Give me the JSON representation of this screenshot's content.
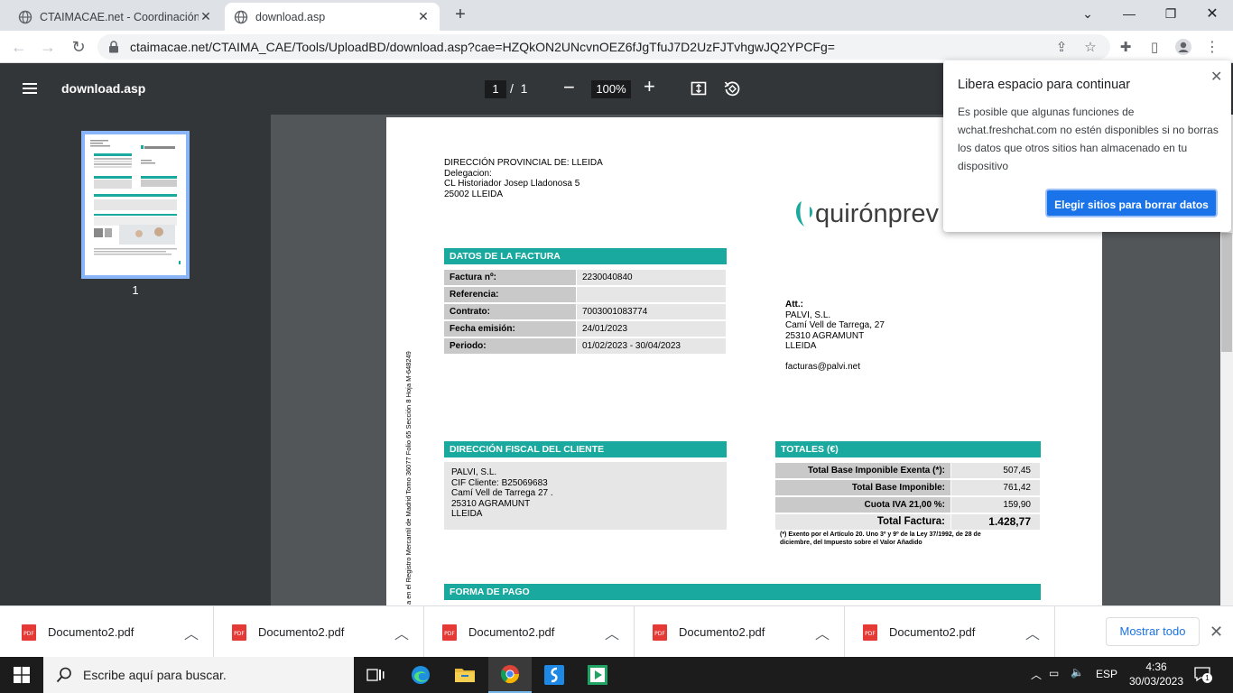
{
  "browser": {
    "tabs": [
      {
        "title": "CTAIMACAE.net - Coordinación de",
        "active": false
      },
      {
        "title": "download.asp",
        "active": true
      }
    ],
    "new_tab_label": "+",
    "url": "ctaimacae.net/CTAIMA_CAE/Tools/UploadBD/download.asp?cae=HZQkON2UNcvnOEZ6fJgTfuJ7D2UzFJTvhgwJQ2YPCFg="
  },
  "pdf_viewer": {
    "file_name": "download.asp",
    "current_page": "1",
    "page_separator": "/",
    "total_pages": "1",
    "zoom": "100%",
    "thumbnail_number": "1"
  },
  "document": {
    "sender": {
      "line1": "DIRECCIÓN PROVINCIAL DE: LLEIDA",
      "line2": "Delegacion:",
      "line3": "CL Historiador Josep Lladonosa 5",
      "line4": "25002 LLEIDA"
    },
    "logo_text": "quirónprev",
    "invoice_section_title": "DATOS DE LA FACTURA",
    "invoice_rows": [
      {
        "label": "Factura nº:",
        "value": "2230040840"
      },
      {
        "label": "Referencia:",
        "value": ""
      },
      {
        "label": "Contrato:",
        "value": "7003001083774"
      },
      {
        "label": "Fecha emisión:",
        "value": "24/01/2023"
      },
      {
        "label": "Periodo:",
        "value": "01/02/2023 - 30/04/2023"
      }
    ],
    "recipient": {
      "line1": "Att.:",
      "line2": "PALVI, S.L.",
      "line3": "Camí Vell de Tarrega, 27",
      "line4": "25310 AGRAMUNT",
      "line5": "LLEIDA",
      "email": "facturas@palvi.net"
    },
    "vertical_note": "a en el Registro Mercantil de Madrid Tomo 36077 Folio 65 Sección 8 Hoja M-648249",
    "fiscal_section_title": "DIRECCIÓN FISCAL DEL CLIENTE",
    "fiscal": {
      "line1": "PALVI, S.L.",
      "line2": "CIF Cliente: B25069683",
      "line3": "Camí Vell de Tarrega  27 .",
      "line4": "25310 AGRAMUNT",
      "line5": "LLEIDA"
    },
    "totals_section_title": "TOTALES (€)",
    "totals_rows": [
      {
        "label": "Total Base Imponible Exenta (*):",
        "value": "507,45"
      },
      {
        "label": "Total Base Imponible:",
        "value": "761,42"
      },
      {
        "label": "Cuota IVA 21,00 %:",
        "value": "159,90"
      }
    ],
    "total_label": "Total Factura:",
    "total_value": "1.428,77",
    "footnote_line1": "(*) Exento por el Artículo 20. Uno 3º y 9º de la Ley 37/1992, de 28 de",
    "footnote_line2": "diciembre, del Impuesto sobre el Valor Añadido",
    "payment_section_title": "FORMA DE PAGO"
  },
  "popup": {
    "title": "Libera espacio para continuar",
    "body": "Es posible que algunas funciones de wchat.freshchat.com no estén disponibles si no borras los datos que otros sitios han almacenado en tu dispositivo",
    "button": "Elegir sitios para borrar datos"
  },
  "downloads": {
    "items": [
      "Documento2.pdf",
      "Documento2.pdf",
      "Documento2.pdf",
      "Documento2.pdf",
      "Documento2.pdf"
    ],
    "show_all": "Mostrar todo"
  },
  "taskbar": {
    "search_placeholder": "Escribe aquí para buscar.",
    "language": "ESP",
    "time": "4:36",
    "date": "30/03/2023",
    "notifications": "1"
  },
  "colors": {
    "accent_teal": "#1aa99f",
    "chrome_blue": "#1a73e8",
    "viewer_dark": "#323639"
  }
}
